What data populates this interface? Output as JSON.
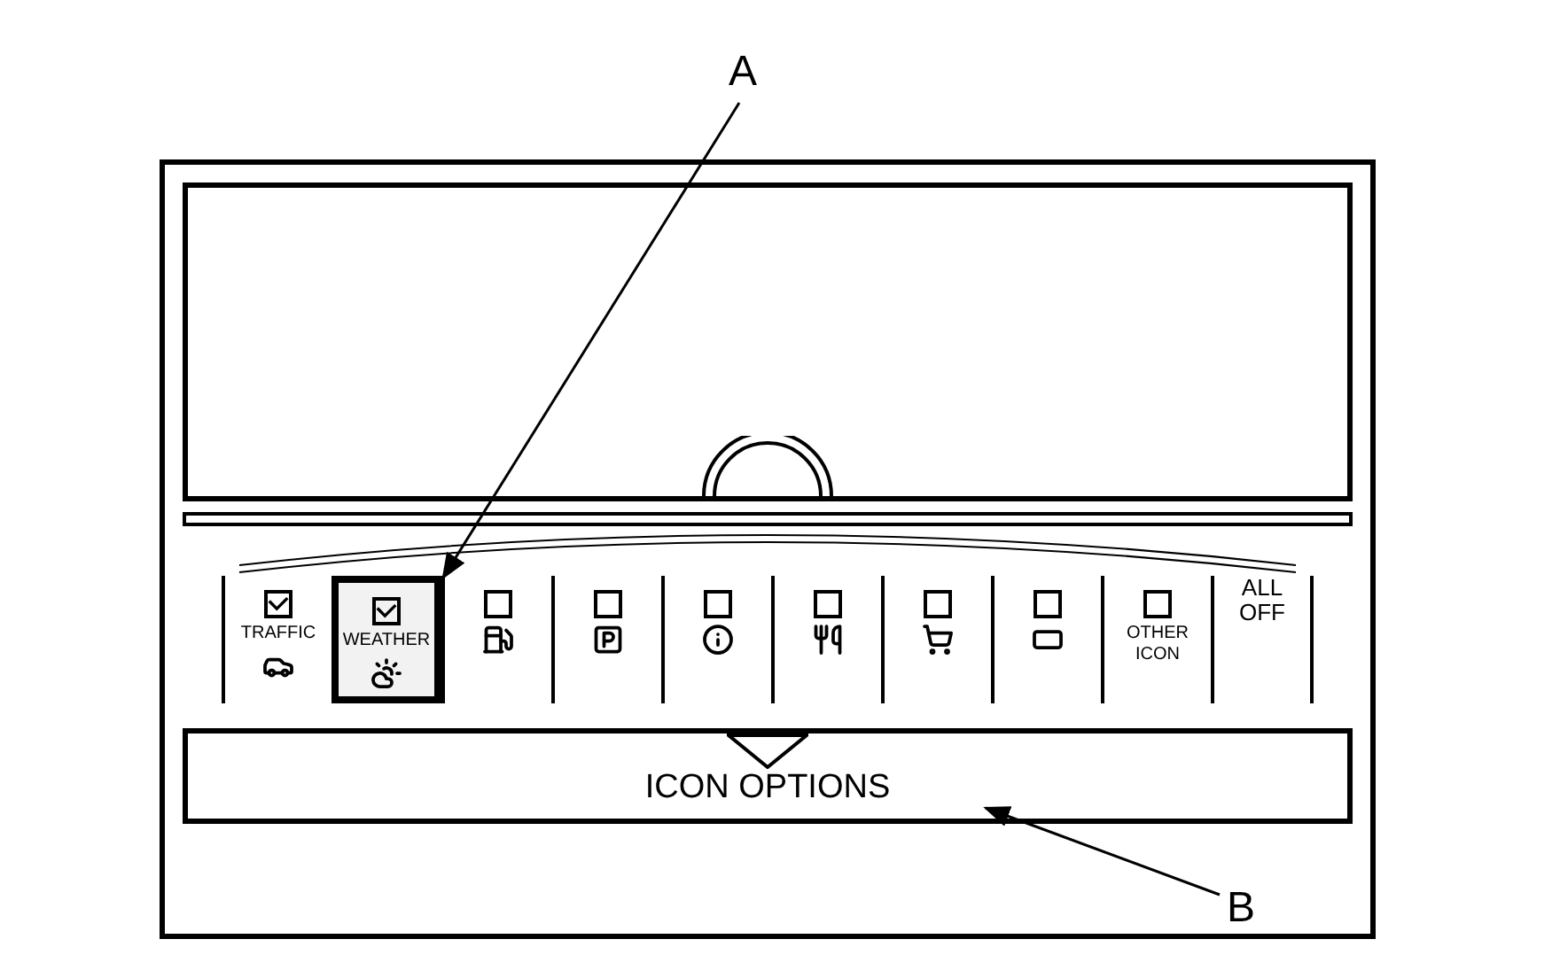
{
  "callouts": [
    {
      "label": "A"
    },
    {
      "label": "B"
    }
  ],
  "icon_bar": {
    "items": [
      {
        "kind": "option",
        "label": "TRAFFIC",
        "checked": true,
        "selected": false
      },
      {
        "kind": "option",
        "label": "WEATHER",
        "checked": true,
        "selected": true
      },
      {
        "kind": "option",
        "checked": false,
        "selected": false
      },
      {
        "kind": "option",
        "checked": false,
        "selected": false
      },
      {
        "kind": "option",
        "checked": false,
        "selected": false
      },
      {
        "kind": "option",
        "checked": false,
        "selected": false
      },
      {
        "kind": "option",
        "checked": false,
        "selected": false
      },
      {
        "kind": "option",
        "checked": false,
        "selected": false
      },
      {
        "kind": "option",
        "label": "OTHER ICON",
        "checked": false,
        "selected": false
      },
      {
        "kind": "button",
        "label": "ALL OFF",
        "selected": false
      }
    ]
  },
  "options_bar": {
    "label": "ICON OPTIONS"
  }
}
